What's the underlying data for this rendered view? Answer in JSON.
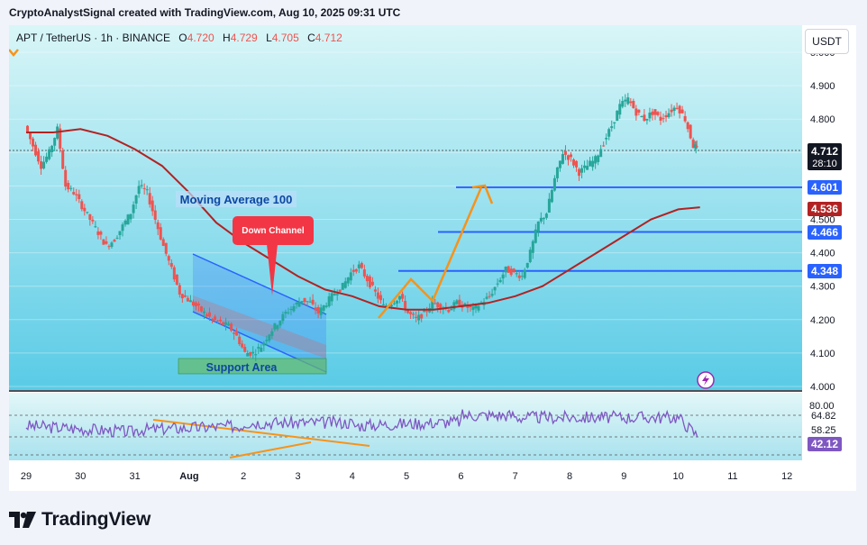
{
  "header": {
    "caption": "CryptoAnalystSignal created with TradingView.com, Aug 10, 2025 09:31 UTC"
  },
  "legend": {
    "symbol": "APT / TetherUS · 1h · BINANCE",
    "o_label": "O",
    "o_value": "4.720",
    "h_label": "H",
    "h_value": "4.729",
    "l_label": "L",
    "l_value": "4.705",
    "c_label": "C",
    "c_value": "4.712"
  },
  "unit_button": "USDT",
  "annotations": {
    "moving_average": "Moving Average 100",
    "down_channel": "Down Channel",
    "support_area": "Support Area"
  },
  "price_badges": {
    "last_price": "4.712",
    "countdown": "28:10",
    "level_1": "4.601",
    "ma_value": "4.536",
    "level_2": "4.466",
    "level_3": "4.348"
  },
  "rsi_badges": {
    "upper": "64.82",
    "mid": "58.25",
    "current": "42.12",
    "clipped": "80.00"
  },
  "brand": "TradingView",
  "colors": {
    "bg_top": "#d9f6f7",
    "bg_bottom": "#59cbe6",
    "up": "#26a69a",
    "down": "#ef5350",
    "ma": "#b22222",
    "level_line": "#2962ff",
    "arrow": "#f7931a",
    "channel_blue": "#2962ff",
    "support_green": "#4caf50",
    "rsi_line": "#7e57c2",
    "trend_orange": "#f7931a"
  },
  "chart_data": {
    "type": "candlestick",
    "timeframe": "1h",
    "ylim": [
      4.0,
      5.0
    ],
    "y_ticks": [
      "4.000",
      "4.100",
      "4.200",
      "4.300",
      "4.400",
      "4.500",
      "4.600",
      "4.700",
      "4.800",
      "4.900",
      "5.000"
    ],
    "x_ticks": [
      "29",
      "30",
      "31",
      "Aug",
      "2",
      "3",
      "4",
      "5",
      "6",
      "7",
      "8",
      "9",
      "10",
      "11",
      "12"
    ],
    "close_path": [
      [
        0,
        4.78
      ],
      [
        0.15,
        4.72
      ],
      [
        0.3,
        4.66
      ],
      [
        0.45,
        4.7
      ],
      [
        0.6,
        4.77
      ],
      [
        0.75,
        4.6
      ],
      [
        0.9,
        4.58
      ],
      [
        1.05,
        4.54
      ],
      [
        1.2,
        4.5
      ],
      [
        1.35,
        4.46
      ],
      [
        1.5,
        4.42
      ],
      [
        1.65,
        4.44
      ],
      [
        1.8,
        4.48
      ],
      [
        1.95,
        4.52
      ],
      [
        2.1,
        4.6
      ],
      [
        2.25,
        4.58
      ],
      [
        2.4,
        4.5
      ],
      [
        2.55,
        4.42
      ],
      [
        2.7,
        4.35
      ],
      [
        2.85,
        4.28
      ],
      [
        3.0,
        4.26
      ],
      [
        3.15,
        4.24
      ],
      [
        3.3,
        4.22
      ],
      [
        3.45,
        4.2
      ],
      [
        3.6,
        4.19
      ],
      [
        3.75,
        4.18
      ],
      [
        3.9,
        4.15
      ],
      [
        4.05,
        4.1
      ],
      [
        4.2,
        4.1
      ],
      [
        4.35,
        4.12
      ],
      [
        4.5,
        4.16
      ],
      [
        4.65,
        4.19
      ],
      [
        4.8,
        4.22
      ],
      [
        4.95,
        4.24
      ],
      [
        5.1,
        4.26
      ],
      [
        5.25,
        4.25
      ],
      [
        5.4,
        4.22
      ],
      [
        5.55,
        4.25
      ],
      [
        5.7,
        4.28
      ],
      [
        5.85,
        4.3
      ],
      [
        6.0,
        4.34
      ],
      [
        6.15,
        4.36
      ],
      [
        6.3,
        4.32
      ],
      [
        6.45,
        4.28
      ],
      [
        6.6,
        4.24
      ],
      [
        6.75,
        4.25
      ],
      [
        6.9,
        4.27
      ],
      [
        7.05,
        4.22
      ],
      [
        7.2,
        4.2
      ],
      [
        7.35,
        4.22
      ],
      [
        7.5,
        4.25
      ],
      [
        7.65,
        4.24
      ],
      [
        7.8,
        4.23
      ],
      [
        7.95,
        4.25
      ],
      [
        8.1,
        4.24
      ],
      [
        8.25,
        4.23
      ],
      [
        8.4,
        4.25
      ],
      [
        8.55,
        4.27
      ],
      [
        8.7,
        4.31
      ],
      [
        8.85,
        4.35
      ],
      [
        9.0,
        4.34
      ],
      [
        9.15,
        4.33
      ],
      [
        9.3,
        4.4
      ],
      [
        9.45,
        4.49
      ],
      [
        9.6,
        4.52
      ],
      [
        9.75,
        4.62
      ],
      [
        9.9,
        4.7
      ],
      [
        10.05,
        4.68
      ],
      [
        10.2,
        4.64
      ],
      [
        10.35,
        4.66
      ],
      [
        10.5,
        4.68
      ],
      [
        10.65,
        4.73
      ],
      [
        10.8,
        4.78
      ],
      [
        10.95,
        4.84
      ],
      [
        11.1,
        4.86
      ],
      [
        11.25,
        4.82
      ],
      [
        11.4,
        4.8
      ],
      [
        11.55,
        4.82
      ],
      [
        11.7,
        4.8
      ],
      [
        11.85,
        4.82
      ],
      [
        12.0,
        4.84
      ],
      [
        12.15,
        4.8
      ],
      [
        12.3,
        4.72
      ],
      [
        12.35,
        4.712
      ]
    ],
    "ma100_path": [
      [
        0,
        4.76
      ],
      [
        0.5,
        4.76
      ],
      [
        1.0,
        4.77
      ],
      [
        1.5,
        4.75
      ],
      [
        2.0,
        4.71
      ],
      [
        2.5,
        4.66
      ],
      [
        3.0,
        4.58
      ],
      [
        3.5,
        4.49
      ],
      [
        4.0,
        4.43
      ],
      [
        4.5,
        4.38
      ],
      [
        5.0,
        4.33
      ],
      [
        5.5,
        4.29
      ],
      [
        6.0,
        4.27
      ],
      [
        6.5,
        4.24
      ],
      [
        7.0,
        4.23
      ],
      [
        7.5,
        4.23
      ],
      [
        8.0,
        4.24
      ],
      [
        8.5,
        4.25
      ],
      [
        9.0,
        4.27
      ],
      [
        9.5,
        4.3
      ],
      [
        10.0,
        4.35
      ],
      [
        10.5,
        4.4
      ],
      [
        11.0,
        4.45
      ],
      [
        11.5,
        4.5
      ],
      [
        12.0,
        4.53
      ],
      [
        12.4,
        4.536
      ]
    ],
    "horizontal_levels": [
      4.601,
      4.466,
      4.348
    ],
    "rsi": {
      "levels": [
        64.82,
        58.25,
        42.12
      ],
      "current": 42.12
    }
  }
}
